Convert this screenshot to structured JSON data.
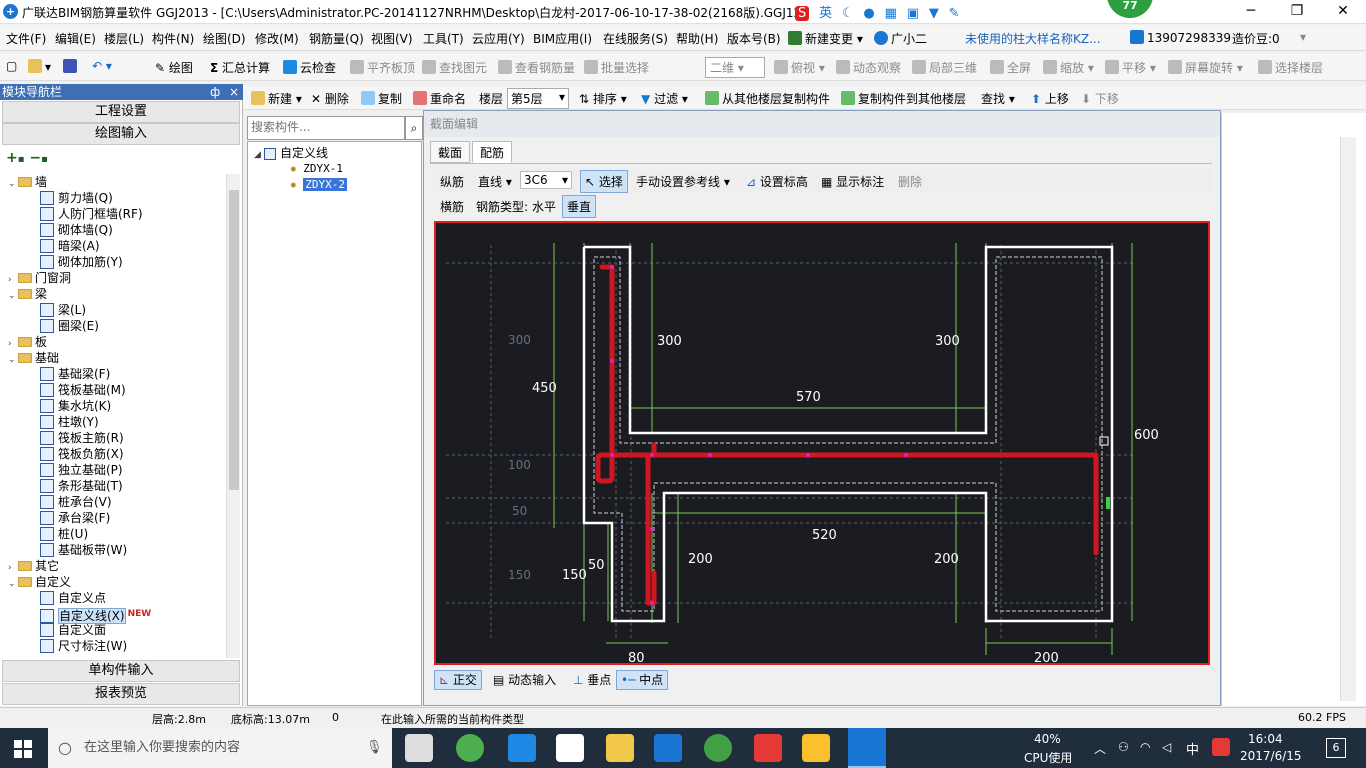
{
  "titlebar": {
    "title": "广联达BIM钢筋算量软件 GGJ2013 - [C:\\Users\\Administrator.PC-20141127NRHM\\Desktop\\白龙村-2017-06-10-17-38-02(2168版).GGJ12",
    "ime_label": "英",
    "badge": "77",
    "minimize": "─",
    "maximize": "❐",
    "close": "✕"
  },
  "menu": {
    "items": [
      "文件(F)",
      "编辑(E)",
      "楼层(L)",
      "构件(N)",
      "绘图(D)",
      "修改(M)",
      "钢筋量(Q)",
      "视图(V)",
      "工具(T)",
      "云应用(Y)",
      "BIM应用(I)",
      "在线服务(S)",
      "帮助(H)",
      "版本号(B)"
    ],
    "new_change": "新建变更",
    "assistant": "广小二",
    "notice": "未使用的柱大样名称KZ...",
    "phone": "13907298339",
    "beans": "造价豆:0"
  },
  "toolbar1": {
    "draw": "绘图",
    "sum": "汇总计算",
    "cloud_check": "云检查",
    "align_top": "平齐板顶",
    "find_element": "查找图元",
    "view_rebar": "查看钢筋量",
    "batch_select": "批量选择",
    "view_mode": "二维",
    "top_view": "俯视",
    "dynamic": "动态观察",
    "local3d": "局部三维",
    "fullscreen": "全屏",
    "zoom": "缩放",
    "pan": "平移",
    "rotate": "屏幕旋转",
    "select_floor": "选择楼层"
  },
  "leftpanel": {
    "header": "模块导航栏",
    "pin": "ф",
    "close": "×",
    "project_settings": "工程设置",
    "drawing_input": "绘图输入",
    "single_input": "单构件输入",
    "report_preview": "报表预览",
    "tree": [
      {
        "label": "墙",
        "level": 0,
        "folder": true,
        "open": true
      },
      {
        "label": "剪力墙(Q)",
        "level": 1
      },
      {
        "label": "人防门框墙(RF)",
        "level": 1
      },
      {
        "label": "砌体墙(Q)",
        "level": 1
      },
      {
        "label": "暗梁(A)",
        "level": 1
      },
      {
        "label": "砌体加筋(Y)",
        "level": 1
      },
      {
        "label": "门窗洞",
        "level": 0,
        "folder": true,
        "open": false
      },
      {
        "label": "梁",
        "level": 0,
        "folder": true,
        "open": true
      },
      {
        "label": "梁(L)",
        "level": 1
      },
      {
        "label": "圈梁(E)",
        "level": 1
      },
      {
        "label": "板",
        "level": 0,
        "folder": true,
        "open": false
      },
      {
        "label": "基础",
        "level": 0,
        "folder": true,
        "open": true
      },
      {
        "label": "基础梁(F)",
        "level": 1
      },
      {
        "label": "筏板基础(M)",
        "level": 1
      },
      {
        "label": "集水坑(K)",
        "level": 1
      },
      {
        "label": "柱墩(Y)",
        "level": 1
      },
      {
        "label": "筏板主筋(R)",
        "level": 1
      },
      {
        "label": "筏板负筋(X)",
        "level": 1
      },
      {
        "label": "独立基础(P)",
        "level": 1
      },
      {
        "label": "条形基础(T)",
        "level": 1
      },
      {
        "label": "桩承台(V)",
        "level": 1
      },
      {
        "label": "承台梁(F)",
        "level": 1
      },
      {
        "label": "桩(U)",
        "level": 1
      },
      {
        "label": "基础板带(W)",
        "level": 1
      },
      {
        "label": "其它",
        "level": 0,
        "folder": true,
        "open": false
      },
      {
        "label": "自定义",
        "level": 0,
        "folder": true,
        "open": true
      },
      {
        "label": "自定义点",
        "level": 1
      },
      {
        "label": "自定义线(X)",
        "level": 1,
        "selected": true
      },
      {
        "label": "自定义面",
        "level": 1
      },
      {
        "label": "尺寸标注(W)",
        "level": 1
      }
    ],
    "new_badge": "NEW"
  },
  "toolbar2": {
    "new": "新建",
    "delete": "删除",
    "copy": "复制",
    "rename": "重命名",
    "floor_label": "楼层",
    "floor_value": "第5层",
    "sort": "排序",
    "filter": "过滤",
    "copy_from": "从其他楼层复制构件",
    "copy_to": "复制构件到其他楼层",
    "find": "查找",
    "move_up": "上移",
    "move_down": "下移"
  },
  "midpanel": {
    "search_placeholder": "搜索构件...",
    "root": "自定义线",
    "items": [
      "ZDYX-1",
      "ZDYX-2"
    ]
  },
  "dialog": {
    "title": "截面编辑",
    "tabs": [
      "截面",
      "配筋"
    ],
    "row1": {
      "long_rebar": "纵筋",
      "line_type": "直线",
      "spec": "3C6",
      "select": "选择",
      "manual_ref": "手动设置参考线",
      "set_elev": "设置标高",
      "show_label": "显示标注",
      "delete": "删除"
    },
    "row2": {
      "transverse": "横筋",
      "rebar_type": "钢筋类型:",
      "horizontal": "水平",
      "vertical": "垂直"
    },
    "bottom": {
      "ortho": "正交",
      "dynamic_input": "动态输入",
      "perp": "垂点",
      "midpoint": "中点"
    },
    "dims": {
      "d300a": "300",
      "d300b": "300",
      "d450": "450",
      "d570": "570",
      "d600": "600",
      "d520": "520",
      "d200a": "200",
      "d200b": "200",
      "d150": "150",
      "d50": "50",
      "d80": "80",
      "d200c": "200",
      "g300": "300",
      "g100": "100",
      "g50": "50",
      "g150": "150"
    }
  },
  "statusbar": {
    "floor_height": "层高:2.8m",
    "bottom_elev": "底标高:13.07m",
    "zero": "0",
    "prompt": "在此输入所需的当前构件类型",
    "fps": "60.2 FPS"
  },
  "taskbar": {
    "search_placeholder": "在这里输入你要搜索的内容",
    "cpu": "40%",
    "cpu_label": "CPU使用",
    "lang": "中",
    "time": "16:04",
    "date": "2017/6/15",
    "notif": "6"
  },
  "colors": {
    "accent": "#1976d2",
    "canvas_bg": "#1b1c22",
    "rebar": "#d0161e",
    "dim": "#7ec850",
    "outline": "#ffffff"
  }
}
